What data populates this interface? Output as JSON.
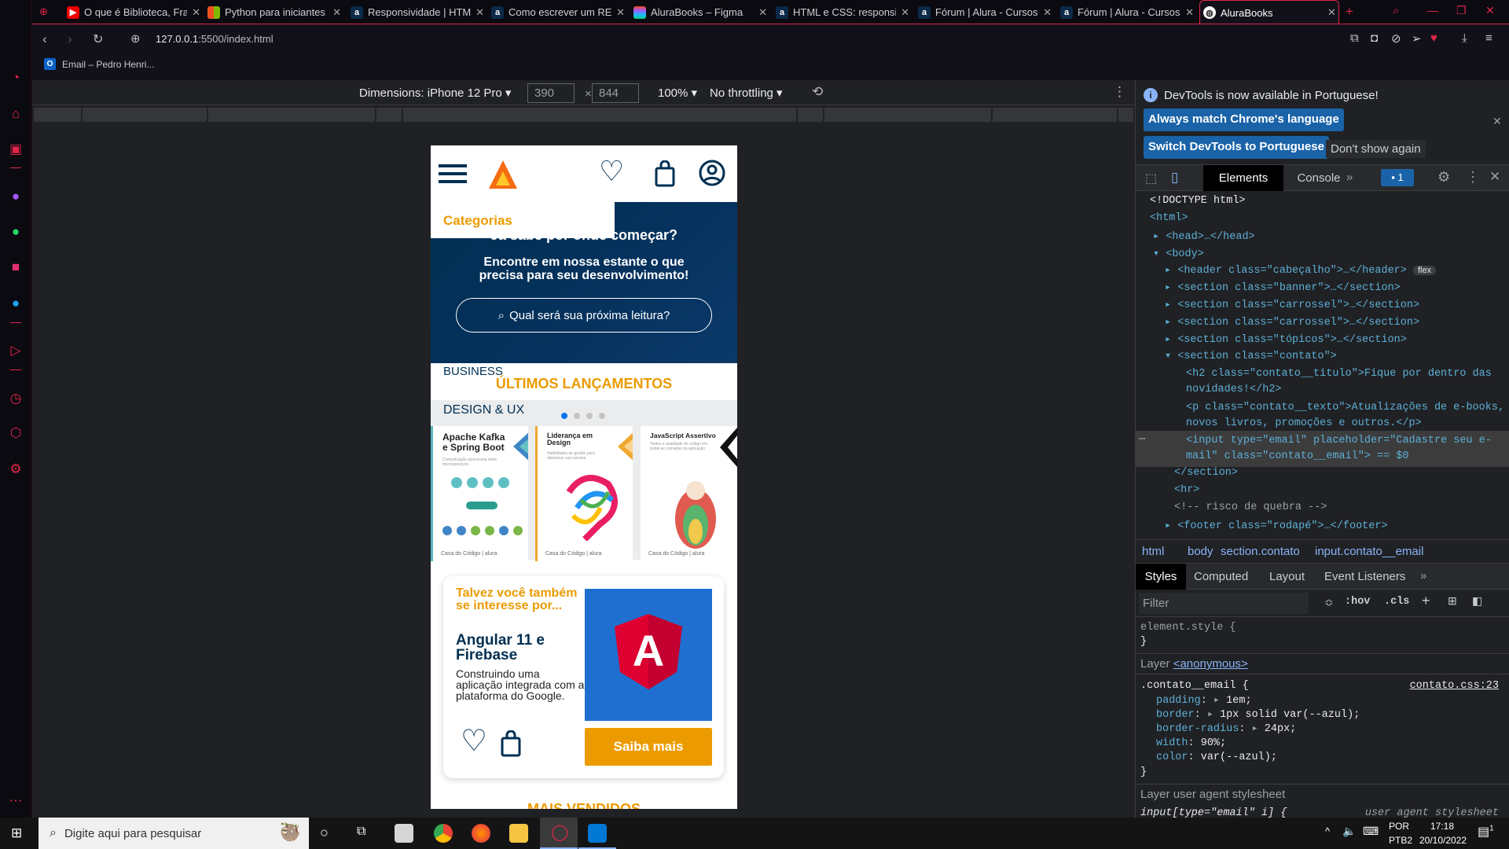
{
  "browser": {
    "tabs": [
      {
        "title": "O que é Biblioteca, Fran",
        "icon": "youtube-icon"
      },
      {
        "title": "Python para iniciantes -",
        "icon": "microsoft-icon"
      },
      {
        "title": "Responsividade | HTML",
        "icon": "alura-icon"
      },
      {
        "title": "Como escrever um REA",
        "icon": "alura-icon"
      },
      {
        "title": "AluraBooks – Figma",
        "icon": "figma-icon"
      },
      {
        "title": "HTML e CSS: responsivid",
        "icon": "alura-icon"
      },
      {
        "title": "Fórum | Alura - Cursos c",
        "icon": "alura-icon"
      },
      {
        "title": "Fórum | Alura - Cursos c",
        "icon": "alura-icon"
      },
      {
        "title": "AluraBooks",
        "icon": "globe-icon",
        "active": true
      }
    ],
    "url_host": "127.0.0.1",
    "url_path": ":5500/index.html",
    "bookmark": "Email – Pedro Henri..."
  },
  "device_toolbar": {
    "dimensions_label": "Dimensions: iPhone 12 Pro",
    "width": "390",
    "height": "844",
    "zoom": "100%",
    "throttling": "No throttling",
    "times": "×"
  },
  "page": {
    "categories": "Categorias",
    "banner_title": "Já sabe por onde começar?",
    "banner_text_1": "Encontre em nossa estante o que",
    "banner_text_2": "precisa para seu desenvolvimento!",
    "search_placeholder": "Qual será sua próxima leitura?",
    "business": "BUSINESS",
    "launch_title": "ÚLTIMOS LANÇAMENTOS",
    "design_ux": "DESIGN & UX",
    "carousel_active_dot": 1,
    "carousel_dots": 4,
    "books": [
      {
        "title": "Apache Kafka e Spring Boot",
        "subtitle": "Comunicação assíncrona entre microsserviços",
        "publisher": "Casa do Código | alura"
      },
      {
        "title": "Liderança em Design",
        "subtitle": "Habilidades de gestão para alavancar sua carreira",
        "publisher": "Casa do Código | alura"
      },
      {
        "title": "JavaScript Assertivo",
        "subtitle": "Testes e qualidade de código em todas as camadas da aplicação",
        "publisher": "Casa do Código | alura"
      }
    ],
    "rec_title": "Talvez você também se interesse por...",
    "rec_book": "Angular 11 e Firebase",
    "rec_desc": "Construindo uma aplicação integrada com a plataforma do Google.",
    "rec_button": "Saiba mais",
    "next_section_partial": "MAIS VENDIDOS"
  },
  "devtools": {
    "info": "DevTools is now available in Portuguese!",
    "btn_match": "Always match Chrome's language",
    "btn_switch": "Switch DevTools to Portuguese",
    "btn_dont_show": "Don't show again",
    "tabs": [
      "Elements",
      "Console"
    ],
    "issues_count": "1",
    "tree": [
      "<!DOCTYPE html>",
      "<html>",
      "<head>…</head>",
      "<body>",
      "<header class=\"cabeçalho\">…</header>",
      "<section class=\"banner\">…</section>",
      "<section class=\"carrossel\">…</section>",
      "<section class=\"carrossel\">…</section>",
      "<section class=\"tópicos\">…</section>",
      "<section class=\"contato\">",
      "<h2 class=\"contato__titulo\">Fique por dentro das novidades!</h2>",
      "<p class=\"contato__texto\">Atualizações de e-books, novos livros, promoções e outros.</p>",
      "<input type=\"email\" placeholder=\"Cadastre seu e-mail\" class=\"contato__email\"> == $0",
      "</section>",
      "<hr>",
      "<!-- risco de quebra  -->",
      "<footer class=\"rodapé\">…</footer>"
    ],
    "flex_badge": "flex",
    "breadcrumbs": [
      "html",
      "body",
      "section.contato",
      "input.contato__email"
    ],
    "style_tabs": [
      "Styles",
      "Computed",
      "Layout",
      "Event Listeners"
    ],
    "filter_placeholder": "Filter",
    "hov": ":hov",
    "cls": ".cls",
    "element_style": "element.style {",
    "close_brace": "}",
    "layer_label": "Layer",
    "layer_name": "<anonymous>",
    "rule_selector": ".contato__email {",
    "rule_source": "contato.css:23",
    "rule_props": [
      {
        "name": "padding",
        "value": "1em;"
      },
      {
        "name": "border",
        "value": "1px solid  var(--azul);"
      },
      {
        "name": "border-radius",
        "value": "24px;"
      },
      {
        "name": "width",
        "value": "90%;"
      },
      {
        "name": "color",
        "value": " var(--azul);"
      }
    ],
    "ua_layer": "Layer user agent stylesheet",
    "ua_rule": "input[type=\"email\" i] {",
    "ua_source": "user agent stylesheet"
  },
  "taskbar": {
    "search_placeholder": "Digite aqui para pesquisar",
    "lang": "POR",
    "kbd": "PTB2",
    "time": "17:18",
    "date": "20/10/2022",
    "notifications": "1"
  }
}
